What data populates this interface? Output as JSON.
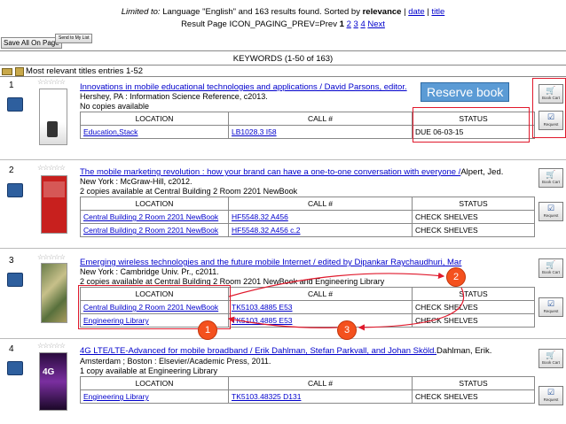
{
  "header": {
    "limited_prefix": "Limited to:",
    "limited_rest": " Language \"English\" and 163 results found. Sorted by",
    "sorted_current": "relevance",
    "sep1": "|",
    "date": "date",
    "sep2": "|",
    "title_sort": "title",
    "result_page": "Result Page ICON_PAGING_PREV=Prev",
    "pages": [
      "1",
      "2",
      "3",
      "4"
    ],
    "next": "Next"
  },
  "toolbar": {
    "save_all": "Save All On Page",
    "send_list": "Send to My List"
  },
  "keywords": "KEYWORDS (1-50 of 163)",
  "section": {
    "label": "Most relevant titles entries 1-52"
  },
  "columns": {
    "location": "LOCATION",
    "call": "CALL #",
    "status": "STATUS"
  },
  "side_buttons": {
    "book_cart": "Book Cart",
    "request": "Request"
  },
  "records": [
    {
      "num": "1",
      "title": "Innovations in mobile educational technologies and applications / David Parsons, editor.",
      "author": "",
      "pub": "Hershey, PA : Information Science Reference, c2013.",
      "availability": "No copies available",
      "holdings": [
        {
          "location": "Education,Stack",
          "call": "LB1028.3 I58",
          "status": "DUE 06-03-15"
        }
      ]
    },
    {
      "num": "2",
      "title": "The mobile marketing revolution : how your brand can have a one-to-one conversation with everyone /",
      "author": " Alpert, Jed.",
      "pub": "New York : McGraw-Hill, c2012.",
      "availability": "2 copies available at Central Building 2 Room 2201 NewBook",
      "holdings": [
        {
          "location": "Central Building 2 Room 2201 NewBook",
          "call": "HF5548.32 A456",
          "status": "CHECK SHELVES"
        },
        {
          "location": "Central Building 2 Room 2201 NewBook",
          "call": "HF5548.32 A456 c.2",
          "status": "CHECK SHELVES"
        }
      ]
    },
    {
      "num": "3",
      "title": "Emerging wireless technologies and the future mobile Internet / edited by Dipankar Raychaudhuri, Mar",
      "author": "",
      "pub": "New York : Cambridge Univ. Pr., c2011.",
      "availability": "2 copies available at Central Building 2 Room 2201 NewBook and Engineering Library",
      "holdings": [
        {
          "location": "Central Building 2 Room 2201 NewBook",
          "call": "TK5103.4885 E53",
          "status": "CHECK SHELVES"
        },
        {
          "location": "Engineering Library",
          "call": "TK5103.4885 E53",
          "status": "CHECK SHELVES"
        }
      ]
    },
    {
      "num": "4",
      "title": "4G LTE/LTE-Advanced for mobile broadband / Erik Dahlman, Stefan Parkvall, and Johan Sköld.",
      "author": " Dahlman, Erik.",
      "pub": "Amsterdam ; Boston : Elsevier/Academic Press, 2011.",
      "availability": "1 copy available at Engineering Library",
      "holdings": [
        {
          "location": "Engineering Library",
          "call": "TK5103.48325 D131",
          "status": "CHECK SHELVES"
        }
      ]
    }
  ],
  "annotations": {
    "reserve": "Reserve book",
    "steps": [
      "1",
      "2",
      "3"
    ],
    "accent": "#e0192c",
    "step_color": "#f4511e",
    "callout_color": "#5b9bd5"
  }
}
